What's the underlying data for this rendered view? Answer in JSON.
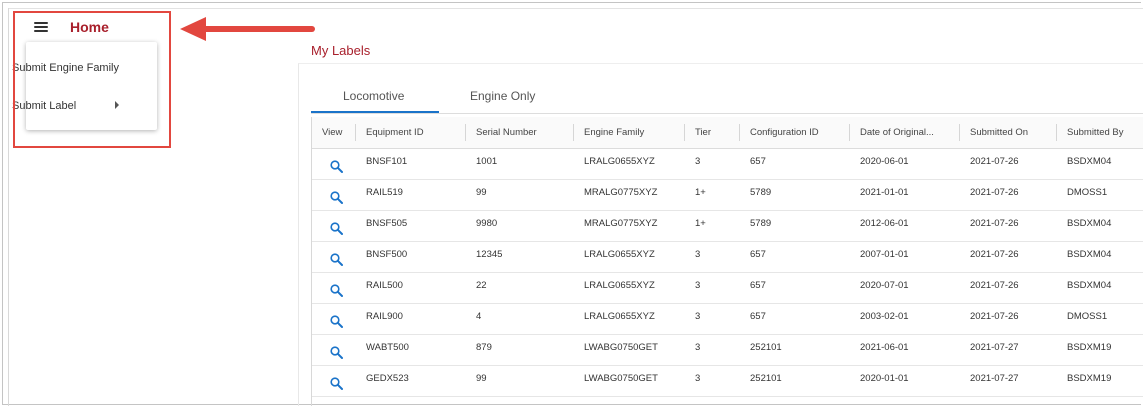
{
  "header": {
    "title": "Home",
    "menu_icon": "hamburger-menu-icon"
  },
  "menu": {
    "items": [
      {
        "label": "Submit Engine Family",
        "has_submenu": false
      },
      {
        "label": "Submit Label",
        "has_submenu": true
      }
    ]
  },
  "annotation": {
    "box_color": "#e2473f",
    "arrow_color": "#e2473f"
  },
  "panel": {
    "title": "My Labels"
  },
  "tabs": [
    {
      "label": "Locomotive",
      "active": true
    },
    {
      "label": "Engine Only",
      "active": false
    }
  ],
  "table": {
    "columns": [
      "View",
      "Equipment ID",
      "Serial Number",
      "Engine Family",
      "Tier",
      "Configuration ID",
      "Date of Original...",
      "Submitted On",
      "Submitted By"
    ],
    "rows": [
      [
        "BNSF101",
        "1001",
        "LRALG0655XYZ",
        "3",
        "657",
        "2020-06-01",
        "2021-07-26",
        "BSDXM04"
      ],
      [
        "RAIL519",
        "99",
        "MRALG0775XYZ",
        "1+",
        "5789",
        "2021-01-01",
        "2021-07-26",
        "DMOSS1"
      ],
      [
        "BNSF505",
        "9980",
        "MRALG0775XYZ",
        "1+",
        "5789",
        "2012-06-01",
        "2021-07-26",
        "BSDXM04"
      ],
      [
        "BNSF500",
        "12345",
        "LRALG0655XYZ",
        "3",
        "657",
        "2007-01-01",
        "2021-07-26",
        "BSDXM04"
      ],
      [
        "RAIL500",
        "22",
        "LRALG0655XYZ",
        "3",
        "657",
        "2020-07-01",
        "2021-07-26",
        "BSDXM04"
      ],
      [
        "RAIL900",
        "4",
        "LRALG0655XYZ",
        "3",
        "657",
        "2003-02-01",
        "2021-07-26",
        "DMOSS1"
      ],
      [
        "WABT500",
        "879",
        "LWABG0750GET",
        "3",
        "252101",
        "2021-06-01",
        "2021-07-27",
        "BSDXM19"
      ],
      [
        "GEDX523",
        "99",
        "LWABG0750GET",
        "3",
        "252101",
        "2020-01-01",
        "2021-07-27",
        "BSDXM19"
      ]
    ]
  },
  "colors": {
    "brand": "#a81f2b",
    "accent": "#1a73c9",
    "view_icon": "#1a73c9"
  }
}
